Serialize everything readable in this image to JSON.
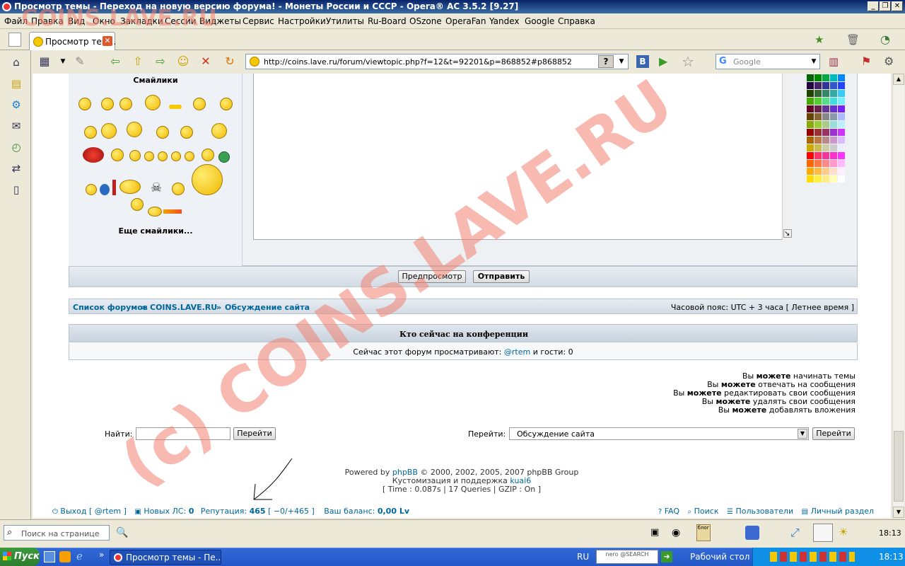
{
  "window": {
    "title": "Просмотр темы - Переход на новую версию форума! - Монеты России и СССР - Opera® AC 3.5.2 [9.27]"
  },
  "menu": [
    "Файл",
    "Правка",
    "Вид",
    "Окно",
    "Закладки",
    "Сессии",
    "Виджеты",
    "Сервис",
    "Настройки",
    "Утилиты",
    "Ru-Board",
    "OSzone",
    "OperaFan",
    "Yandex",
    "Google",
    "Справка"
  ],
  "tab": {
    "label": "Просмотр тем...",
    "close": "✕"
  },
  "address": {
    "url": "http://coins.lave.ru/forum/viewtopic.php?f=12&t=92201&p=868852#p868852",
    "help": "?"
  },
  "search": {
    "placeholder": "Google",
    "engine_letter": "G"
  },
  "smilies": {
    "title": "Смайлики",
    "more": "Еще смайлики..."
  },
  "post_buttons": {
    "preview": "Предпросмотр",
    "submit": "Отправить"
  },
  "breadcrumb": {
    "forums": "Список форумов",
    "sep": "»",
    "site": "COINS.LAVE.RU",
    "section": "Обсуждение сайта",
    "timezone": "Часовой пояс: UTC + 3 часа [ Летнее время ]"
  },
  "online": {
    "title": "Кто сейчас на конференции",
    "text_before": "Сейчас этот форум просматривают:",
    "user": "@rtem",
    "text_after": "и гости: 0"
  },
  "permissions": [
    {
      "pre": "Вы",
      "bold": "можете",
      "post": "начинать темы"
    },
    {
      "pre": "Вы",
      "bold": "можете",
      "post": "отвечать на сообщения"
    },
    {
      "pre": "Вы",
      "bold": "можете",
      "post": "редактировать свои сообщения"
    },
    {
      "pre": "Вы",
      "bold": "можете",
      "post": "удалять свои сообщения"
    },
    {
      "pre": "Вы",
      "bold": "можете",
      "post": "добавлять вложения"
    }
  ],
  "find": {
    "label": "Найти:",
    "value": "",
    "button": "Перейти"
  },
  "jump": {
    "label": "Перейти:",
    "selected": "Обсуждение сайта",
    "button": "Перейти"
  },
  "footer": {
    "powered_pre": "Powered by",
    "powered_link": "phpBB",
    "powered_post": "© 2000, 2002, 2005, 2007 phpBB Group",
    "custom_pre": "Кустомизация и поддержка",
    "custom_link": "kuai6",
    "stats": "[ Time : 0.087s | 17 Queries | GZIP : On ]"
  },
  "userbar": {
    "logout": "Выход [ @rtem ]",
    "pm_label": "Новых ЛС:",
    "pm_count": "0",
    "rep_label": "Репутация:",
    "rep_value": "465",
    "rep_detail": "[ −0/+465 ]",
    "balance_label": "Ваш баланс:",
    "balance_value": "0,00 Lv",
    "faq": "FAQ",
    "search": "Поиск",
    "members": "Пользователи",
    "ucp": "Личный раздел"
  },
  "statusbar": {
    "find_placeholder": "Поиск на странице",
    "clock": "18:13"
  },
  "taskbar": {
    "start": "Пуск",
    "task": "Просмотр темы - Пе...",
    "lang": "RU",
    "nero": "nero @SEARCH",
    "desktop": "Рабочий стол",
    "clock": "18:13",
    "chevron": "»"
  },
  "watermark": {
    "main": "(c) COINS.LAVE.RU",
    "top": "COINS.LAVE.RU"
  },
  "colors": {
    "link": "#006699",
    "watermark": "#f08070"
  }
}
